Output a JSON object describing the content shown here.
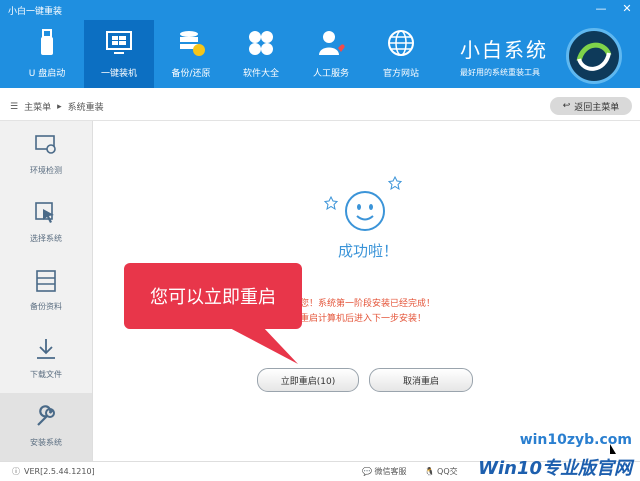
{
  "window": {
    "title": "小白一键重装"
  },
  "nav": {
    "items": [
      {
        "label": "U 盘启动"
      },
      {
        "label": "一键装机"
      },
      {
        "label": "备份/还原"
      },
      {
        "label": "软件大全"
      },
      {
        "label": "人工服务"
      },
      {
        "label": "官方网站"
      }
    ],
    "active_index": 1
  },
  "brand": {
    "name": "小白系统",
    "slogan": "最好用的系统重装工具"
  },
  "breadcrumb": {
    "root": "主菜单",
    "current": "系统重装"
  },
  "back_button": {
    "label": "返回主菜单"
  },
  "sidebar": {
    "items": [
      {
        "label": "环境检测"
      },
      {
        "label": "选择系统"
      },
      {
        "label": "备份资料"
      },
      {
        "label": "下载文件"
      },
      {
        "label": "安装系统"
      }
    ],
    "active_index": 4
  },
  "main": {
    "success": "成功啦！",
    "line1": "您！系统第一阶段安装已经完成！",
    "line2": "重启计算机后进入下一步安装！",
    "restart_button": "立即重启(10)",
    "cancel_button": "取消重启"
  },
  "callout": {
    "text": "您可以立即重启"
  },
  "status": {
    "version": "VER[2.5.44.1210]",
    "wechat": "微信客服",
    "qq": "QQ交"
  },
  "watermark": {
    "url": "win10zyb.com",
    "big": "Win10专业版官网"
  },
  "colors": {
    "header": "#1f8fe0",
    "active": "#0c6fc2",
    "accent": "#e8364a",
    "link": "#3b94d8"
  }
}
